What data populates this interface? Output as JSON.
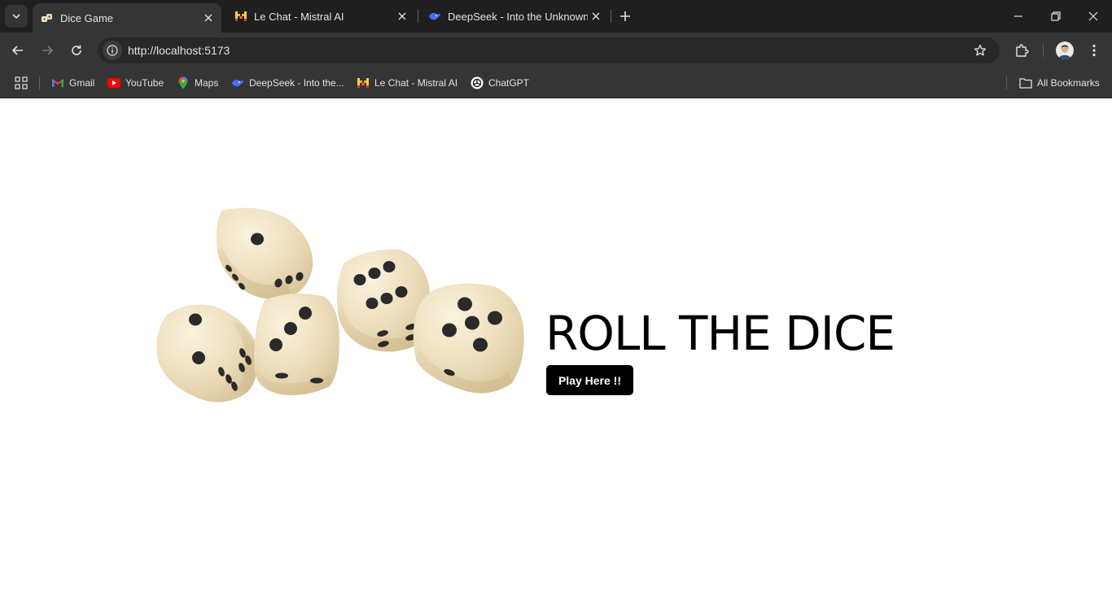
{
  "browser": {
    "tabs": [
      {
        "title": "Dice Game",
        "active": true,
        "icon": "dice-favicon"
      },
      {
        "title": "Le Chat - Mistral AI",
        "active": false,
        "icon": "mistral-favicon"
      },
      {
        "title": "DeepSeek - Into the Unknown",
        "active": false,
        "icon": "deepseek-favicon"
      }
    ],
    "url": "http://localhost:5173",
    "bookmarks": [
      {
        "label": "Gmail",
        "icon": "gmail-icon"
      },
      {
        "label": "YouTube",
        "icon": "youtube-icon"
      },
      {
        "label": "Maps",
        "icon": "maps-icon"
      },
      {
        "label": "DeepSeek - Into the...",
        "icon": "deepseek-icon"
      },
      {
        "label": "Le Chat - Mistral AI",
        "icon": "mistral-icon"
      },
      {
        "label": "ChatGPT",
        "icon": "chatgpt-icon"
      }
    ],
    "all_bookmarks_label": "All Bookmarks"
  },
  "hero": {
    "title": "ROLL THE DICE",
    "button_label": "Play Here !!"
  },
  "colors": {
    "chrome_dark": "#1f1f1f",
    "chrome_mid": "#353535",
    "dice_face": "#efe3c6",
    "pip": "#2a2a2a",
    "button_bg": "#000000",
    "button_text": "#ffffff"
  }
}
